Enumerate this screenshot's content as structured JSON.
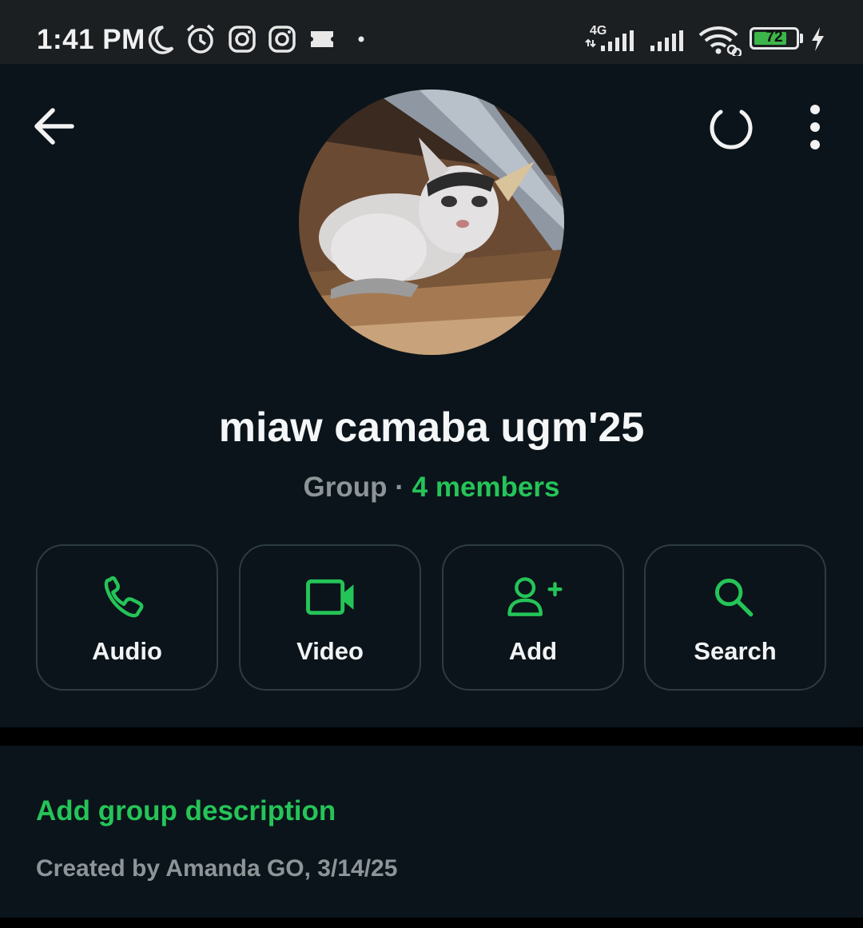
{
  "status_bar": {
    "time": "1:41 PM",
    "battery": "72",
    "network": "4G",
    "icons": [
      "moon-icon",
      "alarm-icon",
      "instagram-icon",
      "instagram-icon",
      "notification-icon",
      "signal-4g-icon",
      "signal-icon",
      "wifi-icon",
      "battery-icon",
      "charging-icon"
    ]
  },
  "header": {
    "back_icon": "arrow-left-icon",
    "sync_icon": "loading-ring-icon",
    "menu_icon": "more-vertical-icon"
  },
  "group": {
    "name": "miaw camaba ugm'25",
    "type": "Group",
    "separator": "·",
    "members": "4 members"
  },
  "actions": [
    {
      "label": "Audio",
      "icon": "phone-icon"
    },
    {
      "label": "Video",
      "icon": "video-camera-icon"
    },
    {
      "label": "Add",
      "icon": "add-person-icon"
    },
    {
      "label": "Search",
      "icon": "search-icon"
    }
  ],
  "description": {
    "add_label": "Add group description",
    "created_by": "Created by Amanda GO, 3/14/25"
  },
  "colors": {
    "accent": "#25c458",
    "background": "#0b141a",
    "muted": "#8d9599"
  }
}
